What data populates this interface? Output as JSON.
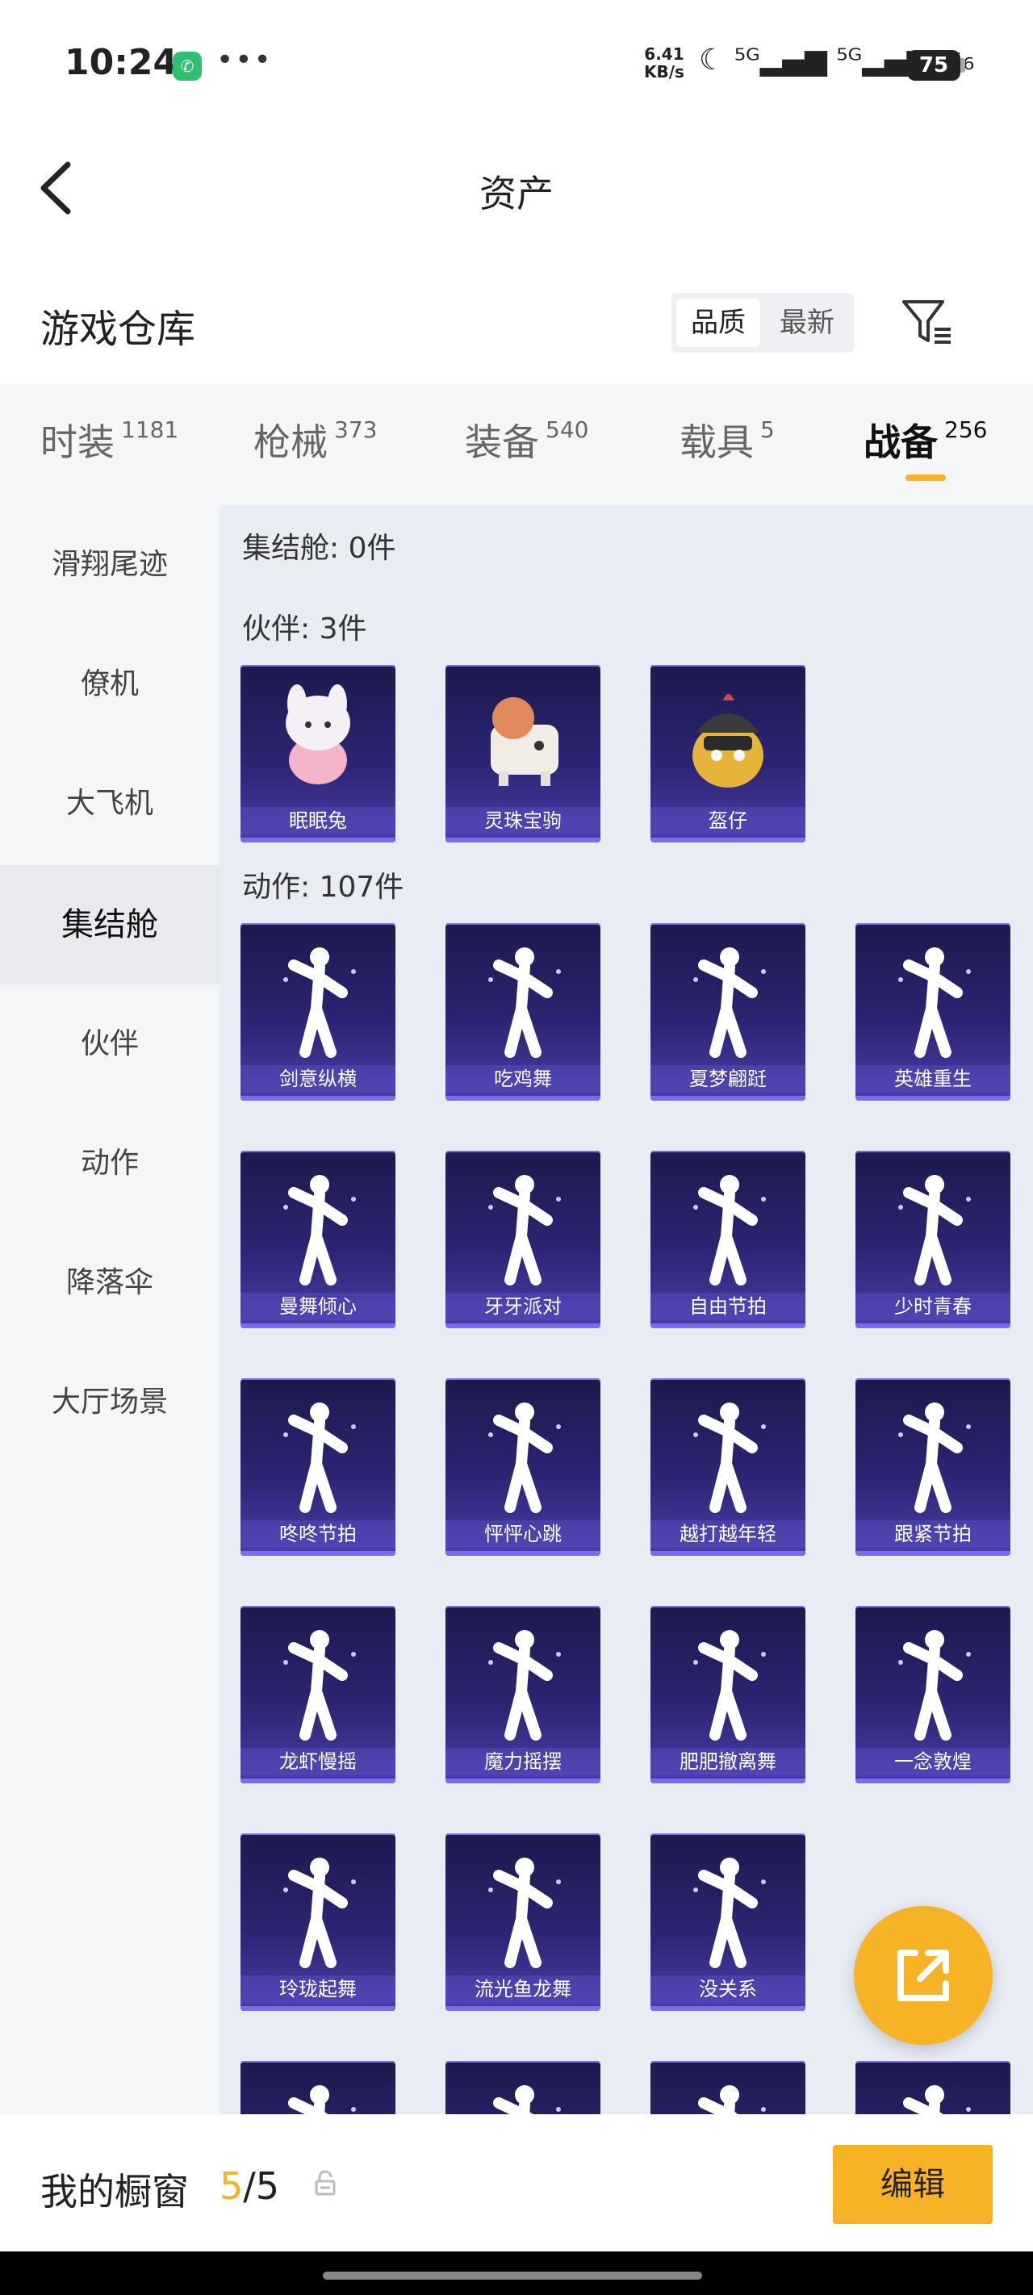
{
  "status": {
    "time": "10:24",
    "speed_value": "6.41",
    "speed_unit": "KB/s",
    "signals": "☾ ⁵ᴳ▂▄▆ ⁵ᴳ▂▄▆ ≋₆",
    "battery": "75"
  },
  "nav": {
    "title": "资产"
  },
  "warehouse": {
    "title": "游戏仓库",
    "sort": [
      "品质",
      "最新"
    ]
  },
  "tabs": [
    {
      "label": "时装",
      "count": "1181"
    },
    {
      "label": "枪械",
      "count": "373"
    },
    {
      "label": "装备",
      "count": "540"
    },
    {
      "label": "载具",
      "count": "5"
    },
    {
      "label": "战备",
      "count": "256"
    }
  ],
  "sidebar": [
    "滑翔尾迹",
    "僚机",
    "大飞机",
    "集结舱",
    "伙伴",
    "动作",
    "降落伞",
    "大厅场景"
  ],
  "sections": {
    "assembly": "集结舱: 0件",
    "partner": "伙伴: 3件",
    "action": "动作: 107件"
  },
  "partners": [
    "眠眠兔",
    "灵珠宝驹",
    "盔仔"
  ],
  "actions": [
    "剑意纵横",
    "吃鸡舞",
    "夏梦翩跹",
    "英雄重生",
    "曼舞倾心",
    "牙牙派对",
    "自由节拍",
    "少时青春",
    "咚咚节拍",
    "怦怦心跳",
    "越打越年轻",
    "跟紧节拍",
    "龙虾慢摇",
    "魔力摇摆",
    "肥肥撤离舞",
    "一念敦煌",
    "玲珑起舞",
    "流光鱼龙舞",
    "没关系"
  ],
  "showcase": {
    "label": "我的橱窗",
    "current": "5",
    "sep": "/",
    "total": "5",
    "edit": "编辑"
  },
  "colors": {
    "accent": "#f5b325",
    "card": "#2c2473"
  }
}
